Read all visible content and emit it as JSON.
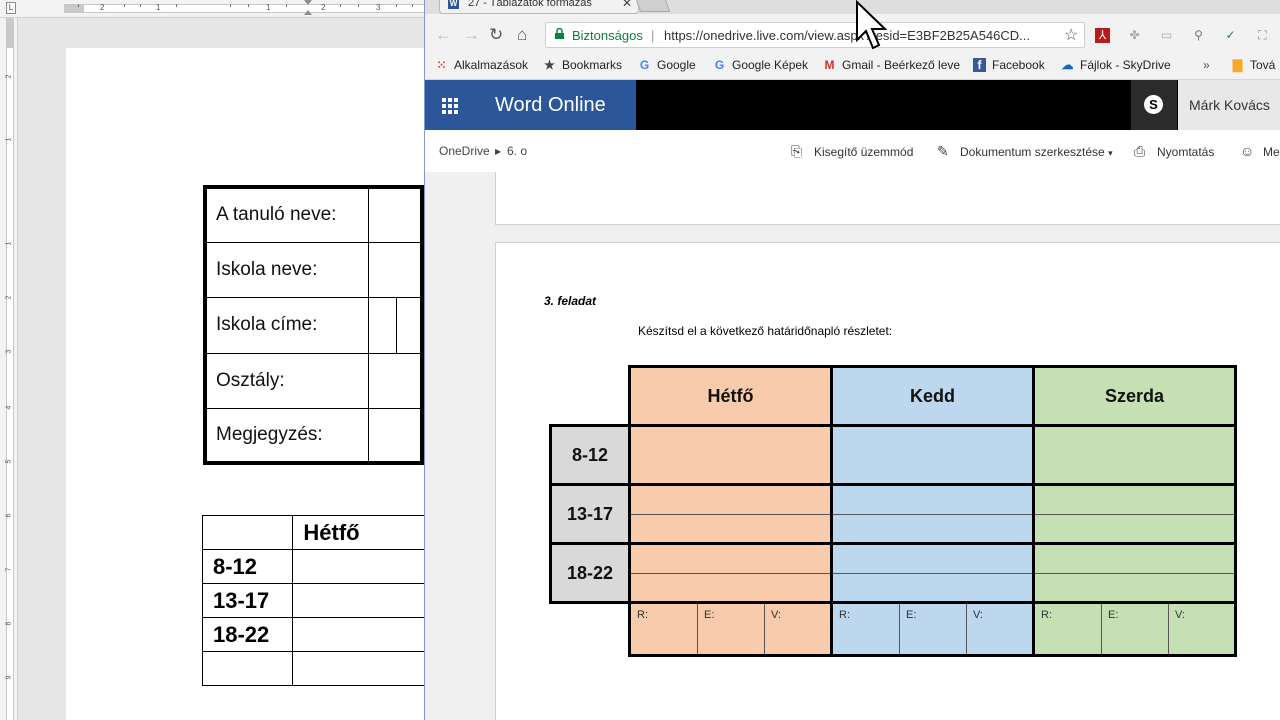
{
  "word_desktop": {
    "ruler_corner": "L",
    "ruler_numbers": [
      "2",
      "1",
      "1",
      "2",
      "3"
    ],
    "vruler_numbers": [
      "2",
      "1",
      "1",
      "2",
      "3",
      "4",
      "5",
      "6",
      "7",
      "8",
      "9"
    ],
    "info_table": [
      {
        "label": "A tanuló neve:"
      },
      {
        "label": "Iskola neve:"
      },
      {
        "label": "Iskola címe:"
      },
      {
        "label": "Osztály:"
      },
      {
        "label": "Megjegyzés:"
      }
    ],
    "schedule_table": {
      "header": [
        "",
        "Hétfő"
      ],
      "rows": [
        "8-12",
        "13-17",
        "18-22",
        ""
      ]
    }
  },
  "browser": {
    "tab_title": "27 - Táblázatok formázás",
    "tab_favicon": "W",
    "tab_close": "✕",
    "security_label": "Biztonságos",
    "url_sep": "|",
    "url": "https://onedrive.live.com/view.aspx?resid=E3BF2B25A546CD...",
    "bookmarks": {
      "apps": "Alkalmazások",
      "items": [
        {
          "label": "Bookmarks",
          "icon": "★",
          "icon_name": "star-icon"
        },
        {
          "label": "Google",
          "icon": "G",
          "icon_name": "google-icon"
        },
        {
          "label": "Google Képek",
          "icon": "G",
          "icon_name": "google-icon"
        },
        {
          "label": "Gmail - Beérkező leve",
          "icon": "M",
          "icon_name": "gmail-icon"
        },
        {
          "label": "Facebook",
          "icon": "f",
          "icon_name": "facebook-icon"
        },
        {
          "label": "Fájlok - SkyDrive",
          "icon": "☁",
          "icon_name": "skydrive-icon"
        }
      ],
      "more": "»",
      "overflow": "Tová"
    }
  },
  "word_online": {
    "app_name": "Word Online",
    "skype_letter": "S",
    "user_name": "Márk Kovács",
    "breadcrumb": [
      "OneDrive",
      "6. o"
    ],
    "commands": {
      "accessibility": "Kisegítő üzemmód",
      "edit": "Dokumentum szerkesztése",
      "edit_arrow": "▾",
      "print": "Nyomtatás",
      "share": "Me"
    },
    "document": {
      "task_title": "3. feladat",
      "task_text": "Készítsd el a következő határidőnapló részletet:",
      "days": [
        "Hétfő",
        "Kedd",
        "Szerda"
      ],
      "time_slots": [
        "8-12",
        "13-17",
        "18-22"
      ],
      "review_labels": [
        "R:",
        "E:",
        "V:"
      ]
    }
  },
  "colors": {
    "word_blue": "#2b579a",
    "monday": "#f7cbab",
    "tuesday": "#bdd7ee",
    "wednesday": "#c6e0b4",
    "time_col": "#d9d9d9",
    "secure_green": "#0b8043"
  }
}
